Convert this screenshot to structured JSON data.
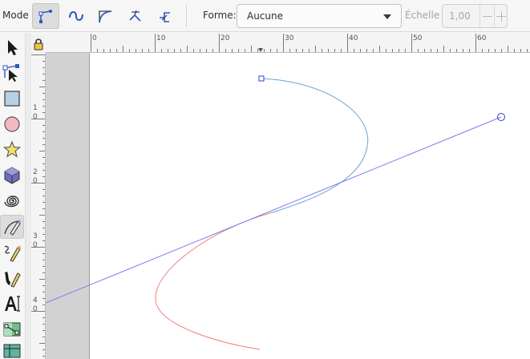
{
  "toolbar": {
    "mode_label": "Mode :",
    "modes": [
      {
        "name": "regular-bezier",
        "active": true
      },
      {
        "name": "spiro"
      },
      {
        "name": "bspline"
      },
      {
        "name": "paraxial"
      },
      {
        "name": "paraxial-alt"
      }
    ],
    "shape_label": "Forme:",
    "shape_value": "Aucune",
    "scale_label": "Échelle :",
    "scale_value": "1,00"
  },
  "tools": [
    "selector-arrow-icon",
    "node-editor-icon",
    "rectangle-icon",
    "circle-icon",
    "star-icon",
    "3d-box-icon",
    "spiral-icon",
    "pen-bezier-icon",
    "pencil-icon",
    "calligraphy-icon",
    "text-icon",
    "gradient-icon",
    "mesh-icon"
  ],
  "rulers": {
    "horizontal": [
      "0",
      "10",
      "20",
      "30",
      "40",
      "50",
      "60"
    ],
    "vertical": [
      "1\n0",
      "2\n0",
      "3\n0",
      "4\n0"
    ]
  },
  "colors": {
    "curve_drawn": "#6aa6d6",
    "curve_preview": "#f07e7e",
    "handle_line": "#7b7bef",
    "desk_gray": "#d2d2d2"
  }
}
